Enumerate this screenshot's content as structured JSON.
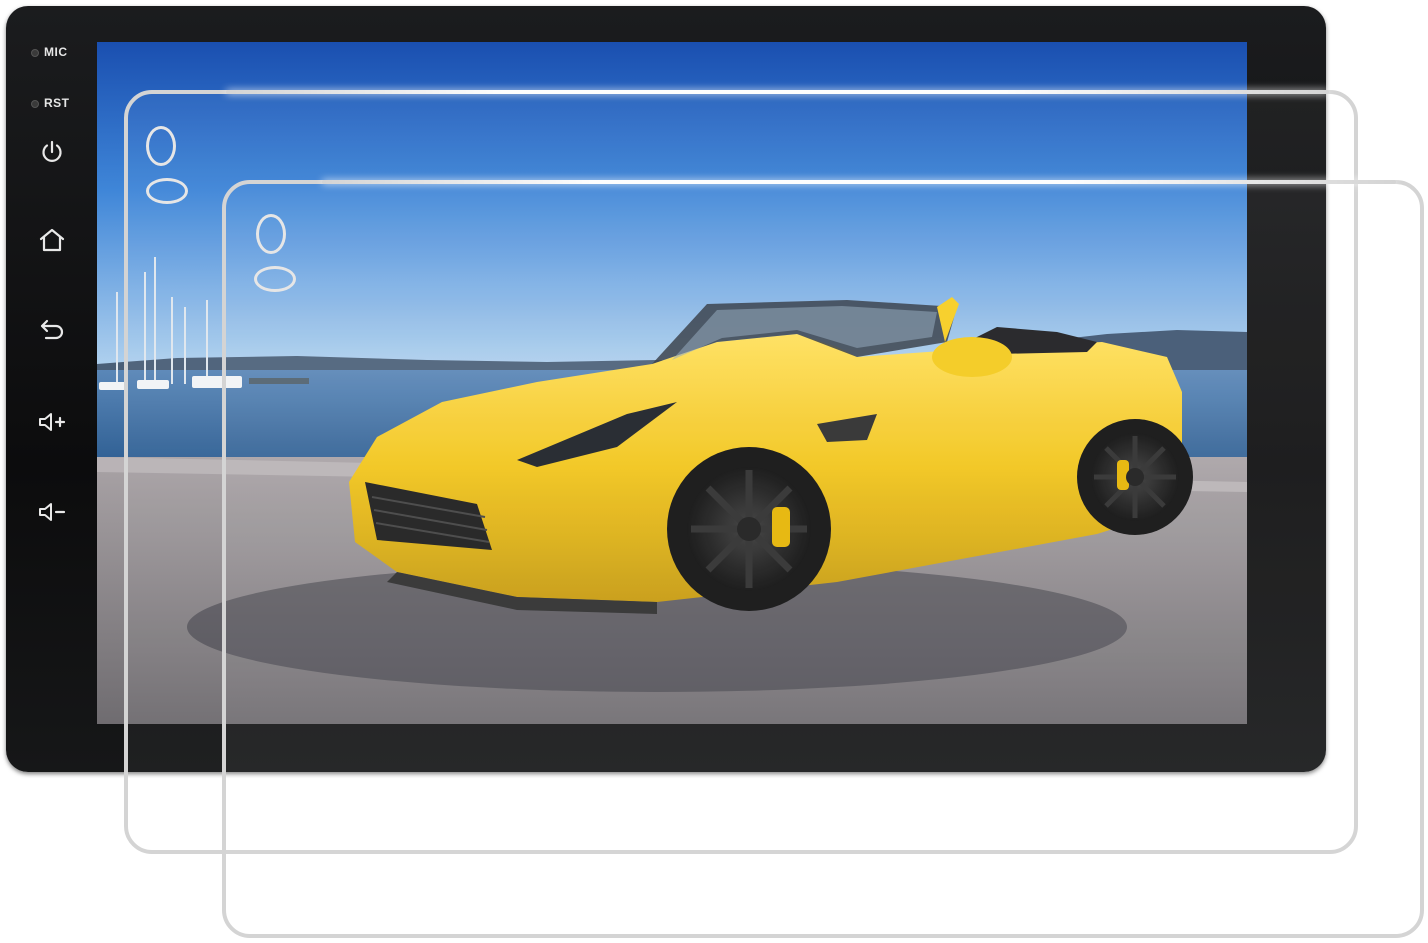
{
  "head_unit": {
    "labels": {
      "mic": "MIC",
      "rst": "RST"
    },
    "buttons": [
      {
        "name": "power-button",
        "icon": "power-icon"
      },
      {
        "name": "home-button",
        "icon": "home-icon"
      },
      {
        "name": "back-button",
        "icon": "back-icon"
      },
      {
        "name": "volume-up-button",
        "icon": "volume-up-icon"
      },
      {
        "name": "volume-down-button",
        "icon": "volume-down-icon"
      }
    ],
    "bezel_color": "#141516"
  },
  "wallpaper": {
    "subject": "yellow-convertible-sports-car",
    "colors": {
      "sky_top": "#1e57b8",
      "sky_bottom": "#9fc6ea",
      "water": "#3f6e9f",
      "ground": "#8d8a8c",
      "car": "#f2c417"
    }
  },
  "screen_protectors": {
    "count": 2,
    "edge_color": "#d4d4d4"
  }
}
